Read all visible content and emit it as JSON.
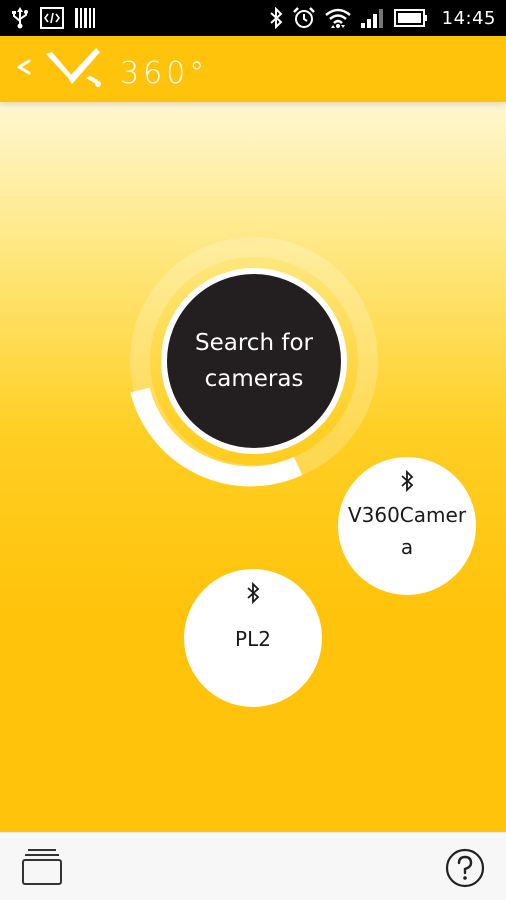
{
  "status_bar": {
    "time": "14:45",
    "icons_left": [
      "usb-icon",
      "code-icon",
      "barcode-icon"
    ],
    "icons_right": [
      "bluetooth-icon",
      "alarm-icon",
      "wifi-icon",
      "signal-icon",
      "battery-icon"
    ]
  },
  "header": {
    "logo_text": "360°",
    "back_icon": "chevron-left-icon"
  },
  "search": {
    "line1": "Search for",
    "line2": "cameras"
  },
  "devices": [
    {
      "name": "V360Camera",
      "icon": "bluetooth-icon"
    },
    {
      "name": "PL2",
      "icon": "bluetooth-icon"
    }
  ],
  "bottom_bar": {
    "left_icon": "gallery-icon",
    "right_icon": "help-icon"
  },
  "colors": {
    "brand_yellow": "#ffc30b",
    "search_button": "#231f20",
    "white": "#ffffff"
  }
}
